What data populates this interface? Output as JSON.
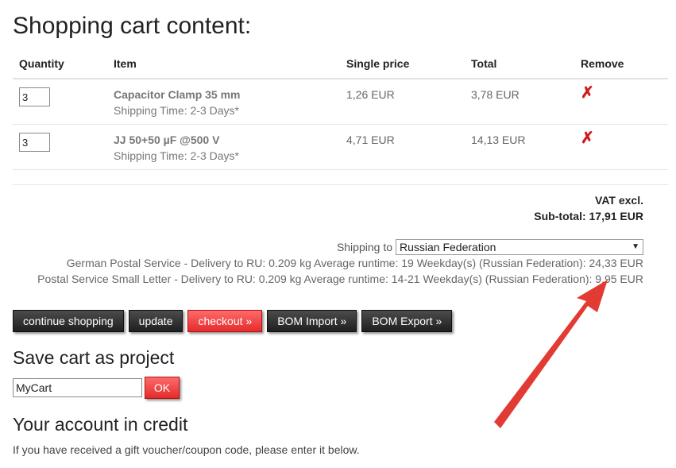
{
  "page_title": "Shopping cart content:",
  "table": {
    "headers": {
      "quantity": "Quantity",
      "item": "Item",
      "single_price": "Single price",
      "total": "Total",
      "remove": "Remove"
    },
    "rows": [
      {
        "qty": "3",
        "name": "Capacitor Clamp 35 mm",
        "shipping": "Shipping Time: 2-3 Days*",
        "single_price": "1,26 EUR",
        "total": "3,78 EUR",
        "remove_glyph": "✗"
      },
      {
        "qty": "3",
        "name": "JJ 50+50 µF @500 V",
        "shipping": "Shipping Time: 2-3 Days*",
        "single_price": "4,71 EUR",
        "total": "14,13 EUR",
        "remove_glyph": "✗"
      }
    ]
  },
  "totals": {
    "vat": "VAT excl.",
    "subtotal": "Sub-total: 17,91 EUR"
  },
  "shipping": {
    "label": "Shipping to",
    "selected_country": "Russian Federation",
    "options": [
      "German Postal Service - Delivery to RU: 0.209 kg Average runtime: 19 Weekday(s) (Russian Federation): 24,33 EUR",
      "Postal Service Small Letter - Delivery to RU: 0.209 kg Average runtime: 14-21 Weekday(s) (Russian Federation): 9,95 EUR"
    ]
  },
  "buttons": {
    "continue": "continue shopping",
    "update": "update",
    "checkout": "checkout »",
    "bom_import": "BOM Import »",
    "bom_export": "BOM Export »"
  },
  "save_project": {
    "title": "Save cart as project",
    "input_value": "MyCart",
    "ok_label": "OK"
  },
  "credit": {
    "title": "Your account in credit",
    "text": "If you have received a gift voucher/coupon code, please enter it below."
  },
  "colors": {
    "accent_red": "#e52b2b",
    "arrow_red": "#e23b33",
    "button_dark": "#2a2a2a"
  }
}
